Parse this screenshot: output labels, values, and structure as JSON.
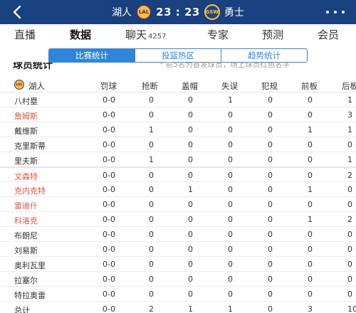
{
  "header": {
    "home_team": "湖人",
    "home_logo": "LAL",
    "score": "23 : 23",
    "away_logo": "GSW",
    "away_team": "勇士",
    "colors": {
      "bar": "#19407f",
      "accent": "#2f86d8",
      "starter": "#e0533b"
    }
  },
  "tabs": [
    {
      "label": "直播",
      "active": false
    },
    {
      "label": "数据",
      "active": true
    },
    {
      "label": "聊天",
      "count": "4257",
      "active": false
    },
    {
      "label": "专家",
      "active": false
    },
    {
      "label": "预测",
      "active": false
    },
    {
      "label": "会员",
      "active": false
    }
  ],
  "subtabs": [
    {
      "label": "比赛统计",
      "active": true
    },
    {
      "label": "投篮热区",
      "active": false
    },
    {
      "label": "趋势统计",
      "active": false
    }
  ],
  "section": {
    "title": "球员统计",
    "note": "* 前5名为首发球员，场上球员红色名字"
  },
  "table": {
    "team": "湖人",
    "team_logo": "LAL",
    "columns": [
      "罚球",
      "抢断",
      "盖帽",
      "失误",
      "犯规",
      "前板",
      "后板"
    ],
    "rows": [
      {
        "name": "八村塁",
        "oncourt": false,
        "values": [
          "0-0",
          "0",
          "0",
          "1",
          "0",
          "0",
          "1"
        ]
      },
      {
        "name": "詹姆斯",
        "oncourt": true,
        "values": [
          "0-0",
          "0",
          "0",
          "0",
          "0",
          "0",
          "3"
        ]
      },
      {
        "name": "戴维斯",
        "oncourt": false,
        "values": [
          "0-0",
          "1",
          "0",
          "0",
          "0",
          "1",
          "1"
        ]
      },
      {
        "name": "克里斯蒂",
        "oncourt": false,
        "values": [
          "0-0",
          "0",
          "0",
          "0",
          "0",
          "0",
          "0"
        ]
      },
      {
        "name": "里夫斯",
        "oncourt": false,
        "values": [
          "0-0",
          "1",
          "0",
          "0",
          "0",
          "0",
          "1"
        ]
      },
      {
        "name": "文森特",
        "oncourt": true,
        "values": [
          "0-0",
          "0",
          "0",
          "0",
          "0",
          "0",
          "2"
        ]
      },
      {
        "name": "克内克特",
        "oncourt": true,
        "values": [
          "0-0",
          "0",
          "1",
          "0",
          "0",
          "1",
          "0"
        ]
      },
      {
        "name": "雷迪什",
        "oncourt": true,
        "values": [
          "0-0",
          "0",
          "0",
          "0",
          "0",
          "0",
          "0"
        ]
      },
      {
        "name": "科洛克",
        "oncourt": true,
        "values": [
          "0-0",
          "0",
          "0",
          "0",
          "0",
          "1",
          "2"
        ]
      },
      {
        "name": "布朗尼",
        "oncourt": false,
        "values": [
          "0-0",
          "0",
          "0",
          "0",
          "0",
          "0",
          "0"
        ]
      },
      {
        "name": "刘易斯",
        "oncourt": false,
        "values": [
          "0-0",
          "0",
          "0",
          "0",
          "0",
          "0",
          "0"
        ]
      },
      {
        "name": "奥利瓦里",
        "oncourt": false,
        "values": [
          "0-0",
          "0",
          "0",
          "0",
          "0",
          "0",
          "0"
        ]
      },
      {
        "name": "拉塞尔",
        "oncourt": false,
        "values": [
          "0-0",
          "0",
          "0",
          "0",
          "0",
          "0",
          "0"
        ]
      },
      {
        "name": "特拉奥雷",
        "oncourt": false,
        "values": [
          "0-0",
          "0",
          "0",
          "0",
          "0",
          "0",
          "0"
        ]
      }
    ],
    "total": {
      "name": "总计",
      "values": [
        "0-0",
        "2",
        "1",
        "1",
        "0",
        "3",
        "10"
      ]
    }
  }
}
